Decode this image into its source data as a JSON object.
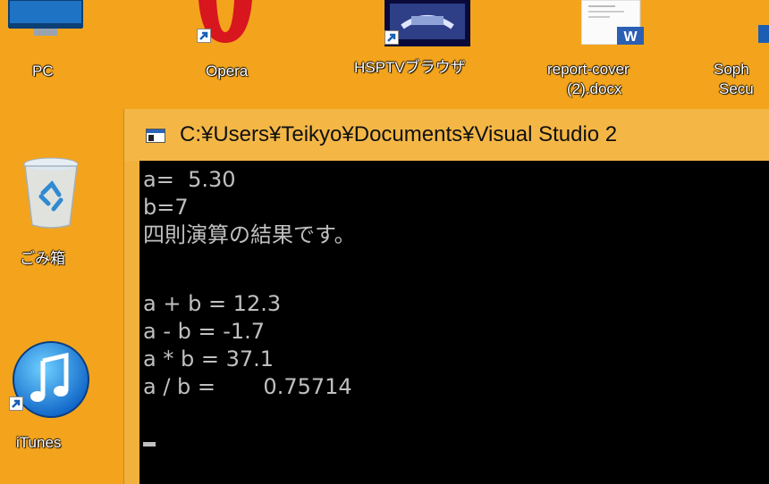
{
  "desktop": {
    "background_color": "#f3a41c",
    "icons": [
      {
        "label": "PC",
        "icon": "monitor-icon"
      },
      {
        "label": "Opera",
        "icon": "opera-icon"
      },
      {
        "label": "HSPTVブラウザ",
        "icon": "hsptv-icon"
      },
      {
        "label": "report-cover",
        "label2": "(2).docx",
        "icon": "word-doc-icon"
      },
      {
        "label": "Soph",
        "label2": "Secu",
        "icon": "sophos-icon"
      },
      {
        "label": "ごみ箱",
        "icon": "recycle-bin-icon"
      },
      {
        "label": "iTunes",
        "icon": "itunes-icon"
      }
    ]
  },
  "console": {
    "title": "C:¥Users¥Teikyo¥Documents¥Visual Studio 2",
    "lines": [
      "a=  5.30",
      "b=7",
      "四則演算の結果です。",
      "",
      "a + b = 12.3",
      "a - b = -1.7",
      "a * b = 37.1",
      "a / b =       0.75714"
    ]
  }
}
